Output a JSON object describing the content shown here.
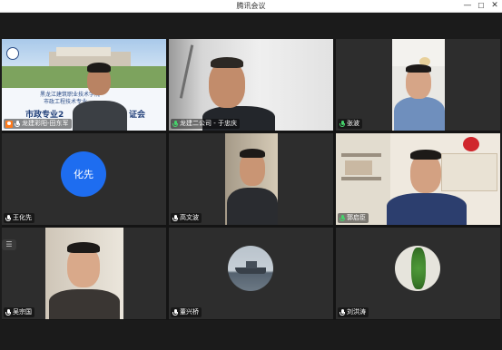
{
  "window": {
    "title": "腾讯会议",
    "minimize": "—",
    "maximize": "☐",
    "close": "✕"
  },
  "slide": {
    "school": "黑龙江建筑职业技术学院",
    "dept": "市政工程技术专业",
    "banner": "市政专业2",
    "banner_right": "证会"
  },
  "tiles": [
    {
      "name": "龙建彩阳-田东军",
      "status": "host"
    },
    {
      "name": "龙建二公司 - 于忠庆",
      "status": "speaking"
    },
    {
      "name": "张波",
      "status": "mic"
    },
    {
      "name": "王化先",
      "status": "avatar",
      "avatar_text": "化先"
    },
    {
      "name": "高文波",
      "status": "mic"
    },
    {
      "name": "郭启臣",
      "status": "mic"
    },
    {
      "name": "吴宗国",
      "status": "avatar"
    },
    {
      "name": "董兴桥",
      "status": "avatar"
    },
    {
      "name": "刘洪涛",
      "status": "avatar"
    }
  ],
  "side_button": "☰",
  "colors": {
    "active_border": "#3fd06a",
    "avatar_blue": "#1e6df0",
    "host_orange": "#ff7a1a"
  }
}
